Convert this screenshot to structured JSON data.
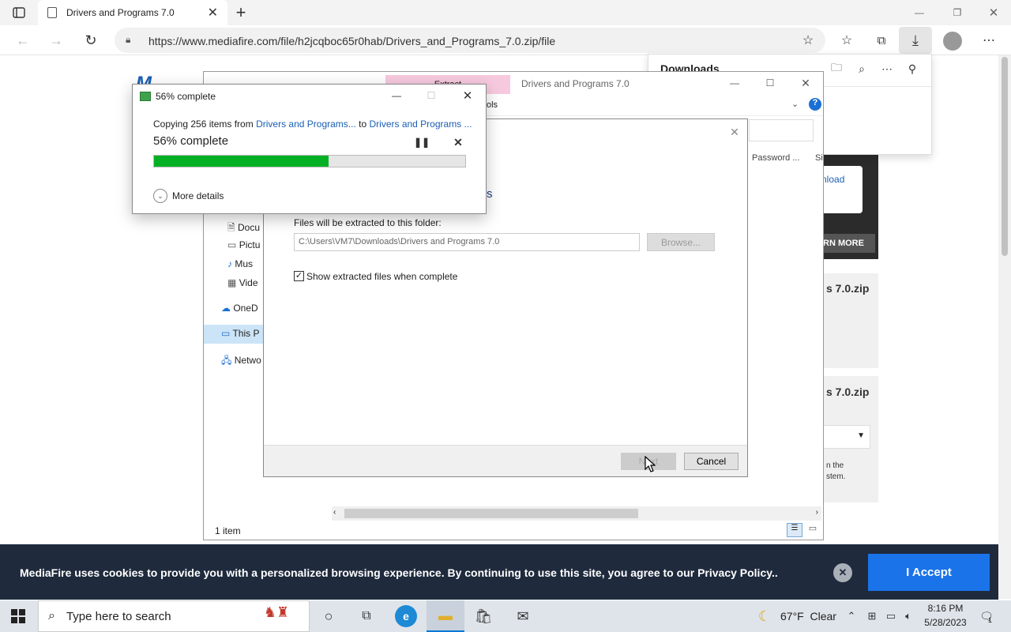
{
  "browser": {
    "tab_title": "Drivers and Programs 7.0",
    "url": "https://www.mediafire.com/file/h2jcqboc65r0hab/Drivers_and_Programs_7.0.zip/file"
  },
  "downloads_panel": {
    "title": "Downloads"
  },
  "page": {
    "side_download_btn": "nload",
    "learn_more": "RN MORE",
    "file1": "s 7.0.zip",
    "file2": "s 7.0.zip",
    "snippet1": "n the",
    "snippet2": "stem."
  },
  "explorer": {
    "title": "Drivers and Programs 7.0",
    "ribbon_tab_extract": "Extract",
    "ribbon_tab_tools": "ols",
    "col_password": "Password ...",
    "col_size": "Si",
    "nav_items": [
      "Docu",
      "Pictu",
      "Mus",
      "Vide",
      "OneD",
      "This P",
      "Netwo"
    ],
    "status": "1 item"
  },
  "wizard": {
    "heading_fragment": "s",
    "folder_label": "Files will be extracted to this folder:",
    "folder_value": "C:\\Users\\VM7\\Downloads\\Drivers and Programs 7.0",
    "browse_label": "Browse...",
    "checkbox_label": "Show extracted files when complete",
    "next_label": "Next",
    "cancel_label": "Cancel"
  },
  "copy_dialog": {
    "title": "56% complete",
    "copying_prefix": "Copying 256 items from",
    "from_link": "Drivers and Programs...",
    "to_word": "to",
    "to_link": "Drivers and Programs ...",
    "percent_text": "56% complete",
    "progress": 0.56,
    "more_details": "More details"
  },
  "cookie_bar": {
    "text": "MediaFire uses cookies to provide you with a personalized browsing experience. By continuing to use this site, you agree to our Privacy Policy..",
    "accept": "I Accept"
  },
  "taskbar": {
    "search_placeholder": "Type here to search",
    "weather": "67°F  Clear",
    "time": "8:16 PM",
    "date": "5/28/2023",
    "notification_count": "1"
  },
  "colors": {
    "accent": "#0078d7",
    "progress_green": "#06b025",
    "cookie_bg": "#1f2a3d",
    "accept_blue": "#1a73e8"
  }
}
